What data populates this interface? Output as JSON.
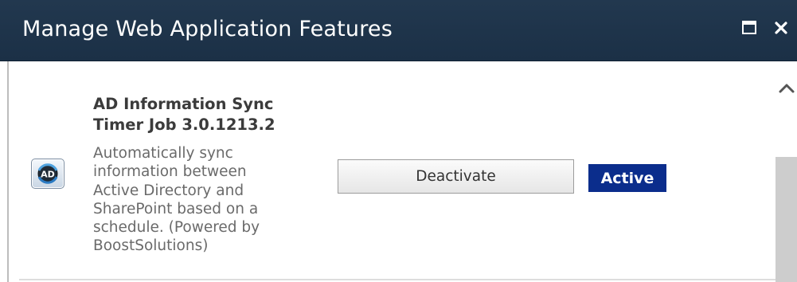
{
  "dialog": {
    "title": "Manage Web Application Features",
    "maximize_icon": "maximize-icon",
    "close_icon": "close-icon"
  },
  "feature": {
    "icon": "ad-sync-icon",
    "icon_text": "AD",
    "title_line1": "AD Information Sync",
    "title_line2": "Timer Job 3.0.1213.2",
    "description_lines": [
      "Automatically sync",
      "information between",
      "Active Directory and",
      "SharePoint based on a",
      "schedule. (Powered by",
      "BoostSolutions)"
    ],
    "action_label": "Deactivate",
    "status": "Active"
  },
  "scrollbar": {
    "up_icon": "chevron-up-icon"
  },
  "colors": {
    "titlebar": "#1f354c",
    "status_badge": "#0b2d8c",
    "title_text": "#3b3b3b",
    "description_text": "#6a6a6a"
  }
}
